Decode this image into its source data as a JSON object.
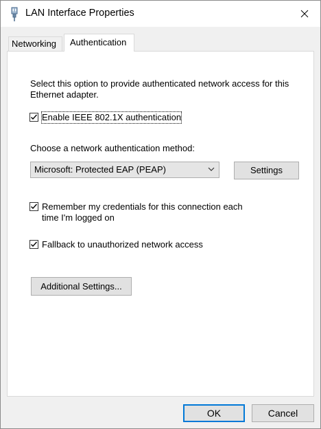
{
  "window": {
    "title": "LAN Interface Properties",
    "icon": "network-adapter-icon"
  },
  "tabs": [
    {
      "label": "Networking",
      "selected": false
    },
    {
      "label": "Authentication",
      "selected": true
    }
  ],
  "auth": {
    "description": "Select this option to provide authenticated network access for this Ethernet adapter.",
    "enable_8021x": {
      "label": "Enable IEEE 802.1X authentication",
      "checked": true
    },
    "method_label": "Choose a network authentication method:",
    "method_value": "Microsoft: Protected EAP (PEAP)",
    "settings_button": "Settings",
    "remember": {
      "label": "Remember my credentials for this connection each time I'm logged on",
      "checked": true
    },
    "fallback": {
      "label": "Fallback to unauthorized network access",
      "checked": true
    },
    "additional_button": "Additional Settings..."
  },
  "footer": {
    "ok": "OK",
    "cancel": "Cancel"
  },
  "colors": {
    "default_button_border": "#0078d7",
    "button_face": "#e1e1e1",
    "dialog_bg": "#f0f0f0"
  }
}
